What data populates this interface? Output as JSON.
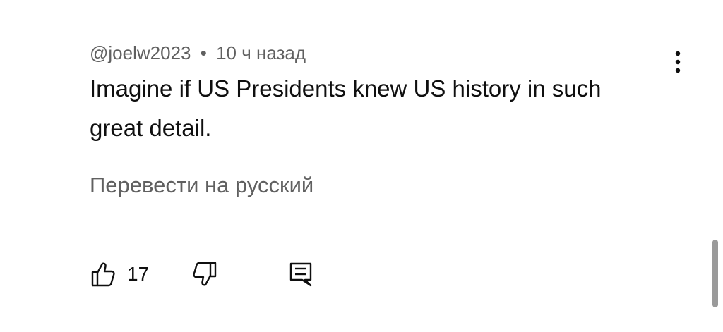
{
  "comment": {
    "author": "@joelw2023",
    "separator": "•",
    "timestamp": "10 ч назад",
    "text": "Imagine if US Presidents knew US history in such great detail.",
    "translate_label": "Перевести на русский"
  },
  "actions": {
    "like_count": "17",
    "like_icon": "thumbs-up-icon",
    "dislike_icon": "thumbs-down-icon",
    "reply_icon": "comment-reply-icon"
  },
  "menu": {
    "icon": "more-vertical-icon"
  },
  "colors": {
    "primary_text": "#0f0f0f",
    "secondary_text": "#606060",
    "background": "#ffffff",
    "scrollbar": "#9a9a9a"
  }
}
